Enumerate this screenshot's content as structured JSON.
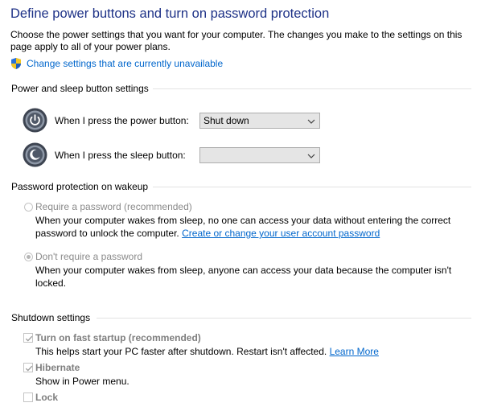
{
  "page": {
    "title": "Define power buttons and turn on password protection",
    "description": "Choose the power settings that you want for your computer. The changes you make to the settings on this page apply to all of your power plans.",
    "change_settings_link": "Change settings that are currently unavailable"
  },
  "power_section": {
    "heading": "Power and sleep button settings",
    "power_button": {
      "label": "When I press the power button:",
      "value": "Shut down"
    },
    "sleep_button": {
      "label": "When I press the sleep button:",
      "value": ""
    }
  },
  "password_section": {
    "heading": "Password protection on wakeup",
    "require": {
      "label": "Require a password (recommended)",
      "description": "When your computer wakes from sleep, no one can access your data without entering the correct password to unlock the computer.",
      "link": "Create or change your user account password",
      "selected": false
    },
    "dont_require": {
      "label": "Don't require a password",
      "description": "When your computer wakes from sleep, anyone can access your data because the computer isn't locked.",
      "selected": true
    }
  },
  "shutdown_section": {
    "heading": "Shutdown settings",
    "fast_startup": {
      "label": "Turn on fast startup (recommended)",
      "description": "This helps start your PC faster after shutdown. Restart isn't affected.",
      "link": "Learn More",
      "checked": true
    },
    "hibernate": {
      "label": "Hibernate",
      "description": "Show in Power menu.",
      "checked": true
    },
    "lock": {
      "label": "Lock",
      "checked": false
    }
  },
  "colors": {
    "title": "#1e3287",
    "link": "#0066cc",
    "disabled_text": "#8a8a8a",
    "section_line": "#e2e2e2"
  },
  "icons": [
    "shield-icon",
    "power-button-icon",
    "sleep-button-icon",
    "chevron-down-icon",
    "checkmark-icon"
  ]
}
